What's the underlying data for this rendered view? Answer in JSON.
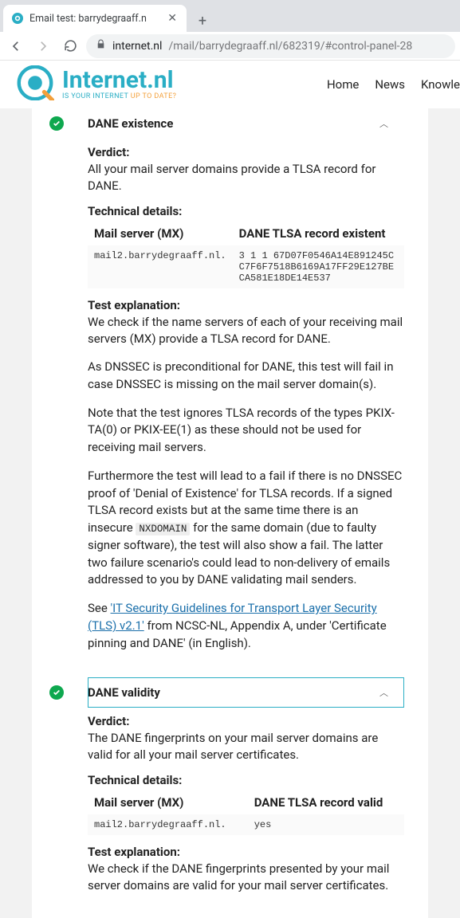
{
  "browser": {
    "tab_title": "Email test: barrydegraaff.n",
    "url_host": "internet.nl",
    "url_rest": "/mail/barrydegraaff.nl/682319/#control-panel-28"
  },
  "header": {
    "brand": "Internet.nl",
    "tag1": "IS YOUR INTERNET ",
    "tag2": "UP TO DATE?",
    "nav": {
      "home": "Home",
      "news": "News",
      "knowle": "Knowle"
    }
  },
  "panels": [
    {
      "title": "DANE existence",
      "verdict_label": "Verdict:",
      "verdict": "All your mail server domains provide a TLSA record for DANE.",
      "tech_label": "Technical details:",
      "th1": "Mail server (MX)",
      "th2": "DANE TLSA record existent",
      "cell1": "mail2.barrydegraaff.nl.",
      "cell2": "3 1 1 67D07F0546A14E891245CC7F6F7518B6169A17FF29E127BECA581E18DE14E537",
      "exp_label": "Test explanation:",
      "exp1": "We check if the name servers of each of your receiving mail servers (MX) provide a TLSA record for DANE.",
      "para2": "As DNSSEC is preconditional for DANE, this test will fail in case DNSSEC is missing on the mail server domain(s).",
      "para3": "Note that the test ignores TLSA records of the types PKIX-TA(0) or PKIX-EE(1) as these should not be used for receiving mail servers.",
      "para4a": "Furthermore the test will lead to a fail if there is no DNSSEC proof of 'Denial of Existence' for TLSA records. If a signed TLSA record exists but at the same time there is an insecure ",
      "nxdomain": "NXDOMAIN",
      "para4b": " for the same domain (due to faulty signer software), the test will also show a fail. The latter two failure scenario's could lead to non-delivery of emails addressed to you by DANE validating mail senders.",
      "para5a": "See ",
      "link": "'IT Security Guidelines for Transport Layer Security (TLS) v2.1'",
      "para5b": " from NCSC-NL, Appendix A, under 'Certificate pinning and DANE' (in English)."
    },
    {
      "title": "DANE validity",
      "verdict_label": "Verdict:",
      "verdict": "The DANE fingerprints on your mail server domains are valid for all your mail server certificates.",
      "tech_label": "Technical details:",
      "th1": "Mail server (MX)",
      "th2": "DANE TLSA record valid",
      "cell1": "mail2.barrydegraaff.nl.",
      "cell2": "yes",
      "exp_label": "Test explanation:",
      "exp1": "We check if the DANE fingerprints presented by your mail server domains are valid for your mail server certificates."
    }
  ]
}
